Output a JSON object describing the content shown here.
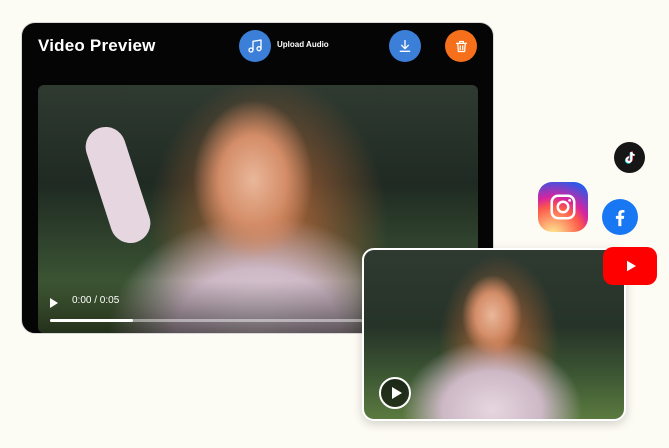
{
  "player": {
    "title": "Video Preview",
    "upload_label": "Upload Audio",
    "time_display": "0:00 / 0:05",
    "progress_fraction": 0.2
  },
  "icons": {
    "upload": "music-note-icon",
    "download": "download-icon",
    "delete": "trash-icon",
    "play": "play-icon"
  },
  "colors": {
    "accent_blue": "#3c7fd9",
    "delete_orange": "#f6701b",
    "background": "#fdfcf4"
  },
  "social": [
    "tiktok-icon",
    "instagram-icon",
    "facebook-icon",
    "youtube-icon"
  ]
}
